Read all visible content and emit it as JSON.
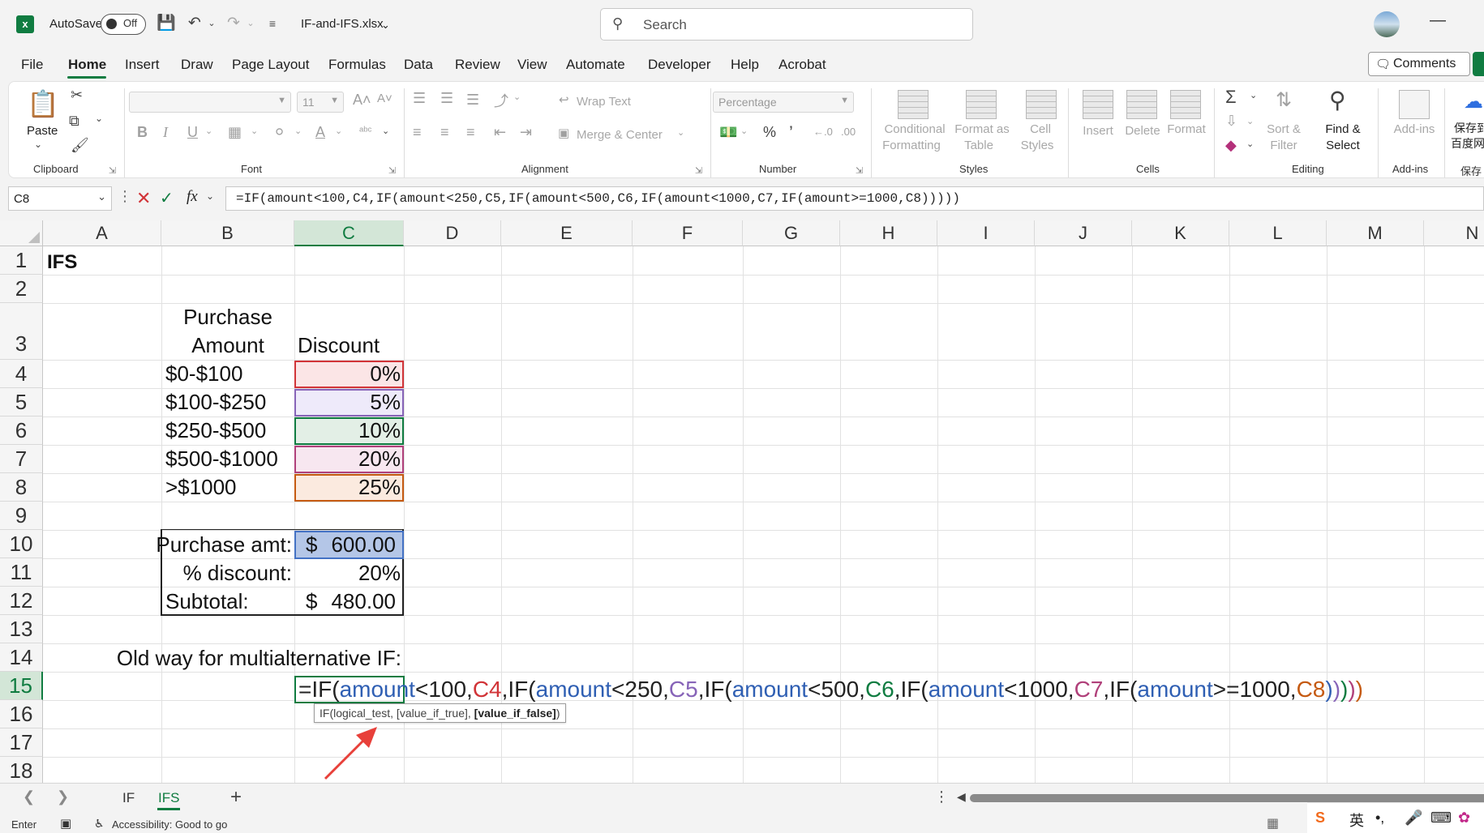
{
  "titlebar": {
    "autosave_label": "AutoSave",
    "autosave_state": "Off",
    "filename": "IF-and-IFS.xlsx",
    "search_placeholder": "Search"
  },
  "menu": {
    "tabs": [
      "File",
      "Home",
      "Insert",
      "Draw",
      "Page Layout",
      "Formulas",
      "Data",
      "Review",
      "View",
      "Automate",
      "Developer",
      "Help",
      "Acrobat"
    ],
    "active_tab": "Home",
    "comments_label": "Comments"
  },
  "ribbon": {
    "clipboard": {
      "paste": "Paste",
      "label": "Clipboard"
    },
    "font": {
      "font_name": "",
      "font_size": "11",
      "label": "Font"
    },
    "alignment": {
      "wrap_text": "Wrap Text",
      "merge_center": "Merge & Center",
      "label": "Alignment"
    },
    "number": {
      "format": "Percentage",
      "label": "Number"
    },
    "styles": {
      "conditional": [
        "Conditional",
        "Formatting"
      ],
      "format_table": [
        "Format as",
        "Table"
      ],
      "cell_styles": [
        "Cell",
        "Styles"
      ],
      "label": "Styles"
    },
    "cells": {
      "insert": "Insert",
      "delete": "Delete",
      "format": "Format",
      "label": "Cells"
    },
    "editing": {
      "sort_filter": [
        "Sort &",
        "Filter"
      ],
      "find_select": [
        "Find &",
        "Select"
      ],
      "label": "Editing"
    },
    "addins": {
      "addins": "Add-ins",
      "label": "Add-ins"
    },
    "baidu": {
      "line1": "保存到",
      "line2": "百度网",
      "label": "保存"
    }
  },
  "formula_bar": {
    "name_box": "C8",
    "formula": "=IF(amount<100,C4,IF(amount<250,C5,IF(amount<500,C6,IF(amount<1000,C7,IF(amount>=1000,C8)))))"
  },
  "grid": {
    "columns": [
      "A",
      "B",
      "C",
      "D",
      "E",
      "F",
      "G",
      "H",
      "I",
      "J",
      "K",
      "L",
      "M",
      "N"
    ],
    "rows": [
      "1",
      "2",
      "3",
      "4",
      "5",
      "6",
      "7",
      "8",
      "9",
      "10",
      "11",
      "12",
      "13",
      "14",
      "15",
      "16",
      "17",
      "18"
    ],
    "selected_column": "C",
    "selected_row": "15",
    "cells": {
      "A1": "IFS",
      "B3_line1": "Purchase",
      "B3_line2": "Amount",
      "C3": "Discount",
      "B4": "$0-$100",
      "C4": "0%",
      "B5": "$100-$250",
      "C5": "5%",
      "B6": "$250-$500",
      "C6": "10%",
      "B7": "$500-$1000",
      "C7": "20%",
      "B8": ">$1000",
      "C8": "25%",
      "B10": "Purchase amt:",
      "C10_sym": "$",
      "C10_val": "600.00",
      "B11": "% discount:",
      "C11": "20%",
      "B12": "Subtotal:",
      "C12_sym": "$",
      "C12_val": "480.00",
      "B14": "Old way for multialternative IF:"
    },
    "edit_formula_parts": [
      {
        "t": "=IF(",
        "c": "#222222"
      },
      {
        "t": "amount",
        "c": "#2f5fb3"
      },
      {
        "t": "<100,",
        "c": "#222222"
      },
      {
        "t": "C4",
        "c": "#d13438"
      },
      {
        "t": ",IF(",
        "c": "#222222"
      },
      {
        "t": "amount",
        "c": "#2f5fb3"
      },
      {
        "t": "<250,",
        "c": "#222222"
      },
      {
        "t": "C5",
        "c": "#8764b8"
      },
      {
        "t": ",IF(",
        "c": "#222222"
      },
      {
        "t": "amount",
        "c": "#2f5fb3"
      },
      {
        "t": "<500,",
        "c": "#222222"
      },
      {
        "t": "C6",
        "c": "#107c41"
      },
      {
        "t": ",IF(",
        "c": "#222222"
      },
      {
        "t": "amount",
        "c": "#2f5fb3"
      },
      {
        "t": "<1000,",
        "c": "#222222"
      },
      {
        "t": "C7",
        "c": "#b0407a"
      },
      {
        "t": ",IF(",
        "c": "#222222"
      },
      {
        "t": "amount",
        "c": "#2f5fb3"
      },
      {
        "t": ">=1000,",
        "c": "#222222"
      },
      {
        "t": "C8",
        "c": "#c55a11"
      },
      {
        "t": ")",
        "c": "#2f5fb3"
      },
      {
        "t": ")",
        "c": "#8764b8"
      },
      {
        "t": ")",
        "c": "#107c41"
      },
      {
        "t": ")",
        "c": "#b0407a"
      },
      {
        "t": ")",
        "c": "#c55a11"
      }
    ],
    "tooltip": {
      "prefix": "IF(logical_test, [value_if_true], ",
      "bold": "[value_if_false]",
      "suffix": ")"
    }
  },
  "sheet_tabs": {
    "tabs": [
      "IF",
      "IFS"
    ],
    "active": "IFS"
  },
  "status_bar": {
    "mode": "Enter",
    "accessibility": "Accessibility: Good to go"
  },
  "ime": {
    "lang": "英"
  },
  "colors": {
    "excel_green": "#107c41",
    "c4_border": "#d13438",
    "c4_fill": "#fbe5e6",
    "c5_border": "#8764b8",
    "c5_fill": "#eeeafa",
    "c6_border": "#107c41",
    "c6_fill": "#e3efe6",
    "c7_border": "#b0407a",
    "c7_fill": "#f7e7f0",
    "c8_border": "#c55a11",
    "c8_fill": "#fbeadf",
    "c10_fill": "#b4c6e7"
  }
}
